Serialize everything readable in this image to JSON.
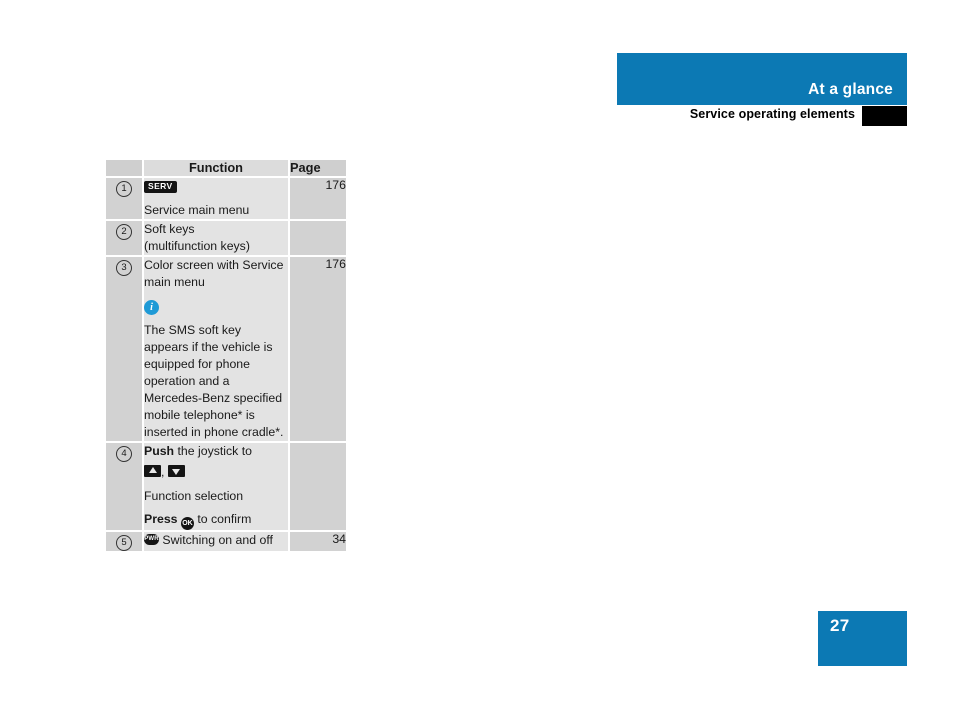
{
  "header": {
    "title": "At a glance",
    "subtitle": "Service operating elements",
    "accent_color": "#0c79b4",
    "tab_color": "#000000"
  },
  "table": {
    "columns": {
      "number": "",
      "function": "Function",
      "page": "Page"
    },
    "rows": [
      {
        "number": "1",
        "icon": "serv-badge",
        "icon_label": "SERV",
        "text": "Service main menu",
        "page": "176"
      },
      {
        "number": "2",
        "line1": "Soft keys",
        "line2": "(multifunction keys)",
        "page": ""
      },
      {
        "number": "3",
        "line1": "Color screen with Service",
        "line2": "main menu",
        "note_icon": "info-icon",
        "note": "The SMS soft key appears if the vehicle is equipped for phone operation and a Mercedes-Benz specified mobile telephone* is inserted in phone cradle*.",
        "page": "176"
      },
      {
        "number": "4",
        "push_bold": "Push",
        "push_rest": " the joystick to",
        "arrow_up": "up-arrow-key",
        "arrow_sep": ",",
        "arrow_down": "down-arrow-key",
        "selection": "Function selection",
        "press_bold": "Press",
        "press_icon": "OK",
        "press_rest": " to confirm",
        "page": ""
      },
      {
        "number": "5",
        "icon_label": "PWR",
        "text": " Switching on and off",
        "page": "34"
      }
    ]
  },
  "footer": {
    "page_number": "27",
    "accent_color": "#0c79b4"
  }
}
